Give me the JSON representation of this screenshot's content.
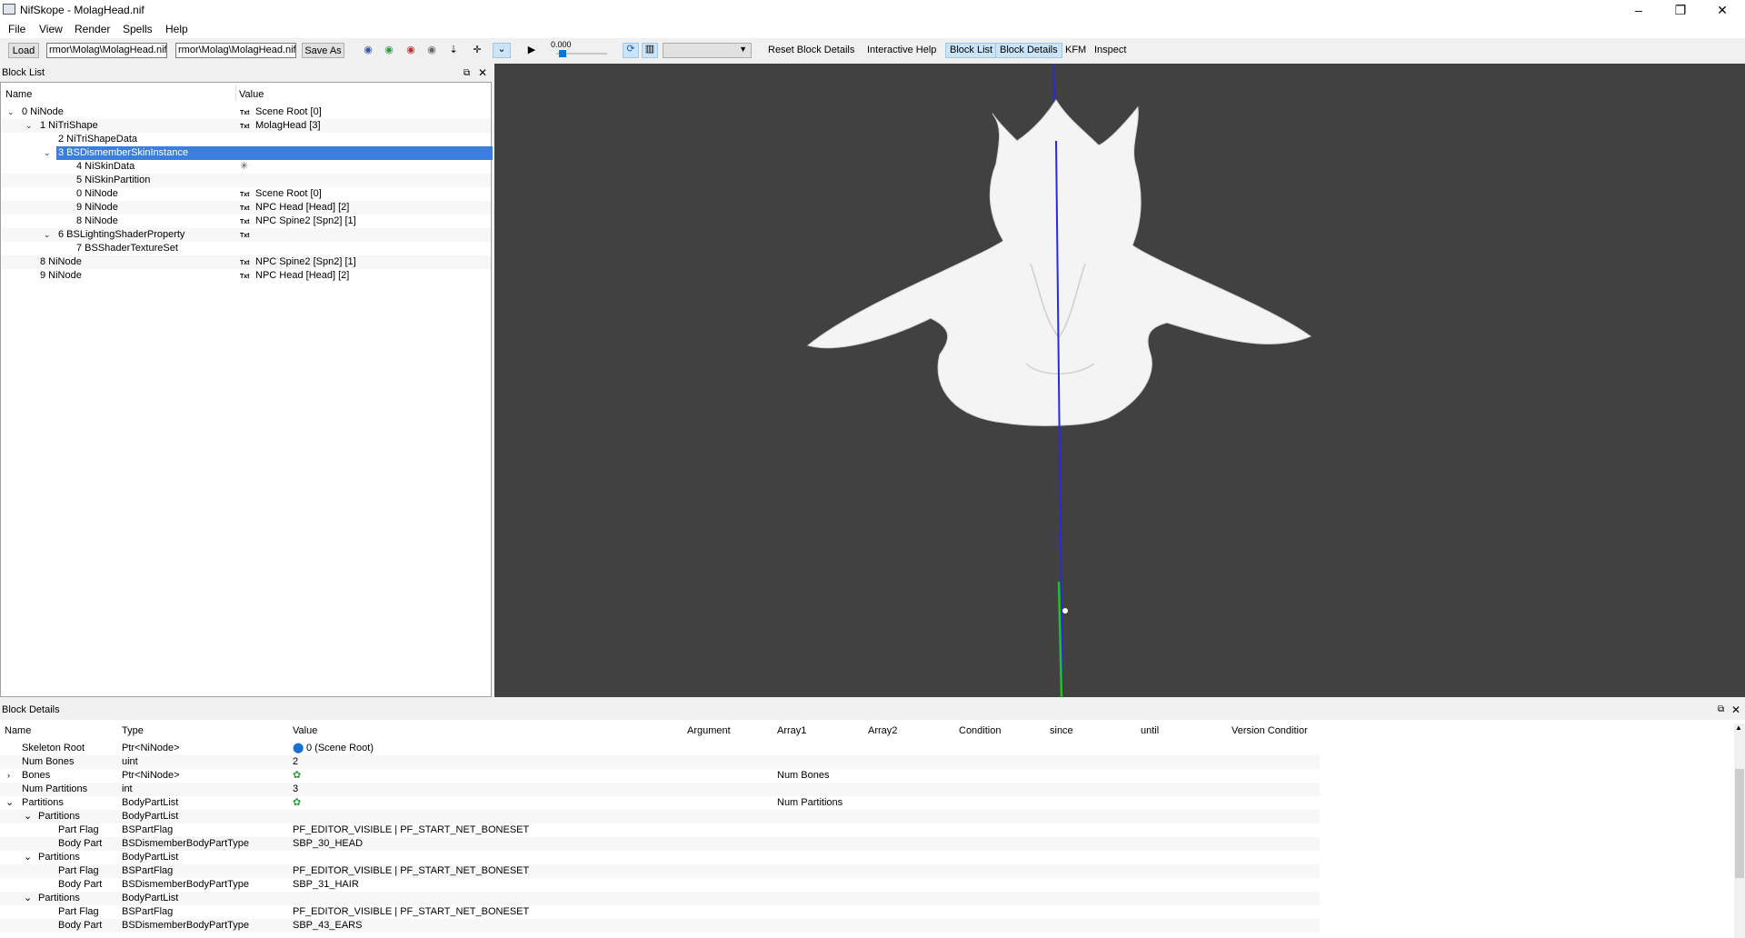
{
  "window": {
    "title": "NifSkope - MolagHead.nif",
    "controls": [
      "–",
      "❐",
      "✕"
    ]
  },
  "menu": [
    "File",
    "View",
    "Render",
    "Spells",
    "Help"
  ],
  "toolbar": {
    "load_label": "Load",
    "load_path": "rmor\\Molag\\MolagHead.nif",
    "save_path": "rmor\\Molag\\MolagHead.nif",
    "save_as_label": "Save As",
    "time_value": "0.000",
    "reset_label": "Reset Block Details",
    "help_label": "Interactive Help",
    "blocklist_label": "Block List",
    "blockdetails_label": "Block Details",
    "kfm_label": "KFM",
    "inspect_label": "Inspect"
  },
  "blocklist": {
    "panel_title": "Block List",
    "col_name": "Name",
    "col_value": "Value",
    "rows": [
      {
        "name": "0 NiNode",
        "value": "Scene Root [0]",
        "txt": "Txt"
      },
      {
        "name": "1 NiTriShape",
        "value": "MolagHead [3]",
        "txt": "Txt"
      },
      {
        "name": "2 NiTriShapeData",
        "value": "",
        "txt": ""
      },
      {
        "name": "3 BSDismemberSkinInstance",
        "value": "",
        "txt": ""
      },
      {
        "name": "4 NiSkinData",
        "value": "✳",
        "txt": ""
      },
      {
        "name": "5 NiSkinPartition",
        "value": "",
        "txt": ""
      },
      {
        "name": "0 NiNode",
        "value": "Scene Root [0]",
        "txt": "Txt"
      },
      {
        "name": "9 NiNode",
        "value": "NPC Head [Head] [2]",
        "txt": "Txt"
      },
      {
        "name": "8 NiNode",
        "value": "NPC Spine2 [Spn2] [1]",
        "txt": "Txt"
      },
      {
        "name": "6 BSLightingShaderProperty",
        "value": "",
        "txt": "Txt"
      },
      {
        "name": "7 BSShaderTextureSet",
        "value": "",
        "txt": ""
      },
      {
        "name": "8 NiNode",
        "value": "NPC Spine2 [Spn2] [1]",
        "txt": "Txt"
      },
      {
        "name": "9 NiNode",
        "value": "NPC Head [Head] [2]",
        "txt": "Txt"
      }
    ]
  },
  "details": {
    "panel_title": "Block Details",
    "columns": [
      "Name",
      "Type",
      "Value",
      "Argument",
      "Array1",
      "Array2",
      "Condition",
      "since",
      "until",
      "Version Conditior"
    ],
    "rows": [
      {
        "name": "Skeleton Root",
        "type": "Ptr<NiNode>",
        "value": "0 (Scene Root)",
        "array1": ""
      },
      {
        "name": "Num Bones",
        "type": "uint",
        "value": "2",
        "array1": ""
      },
      {
        "name": "Bones",
        "type": "Ptr<NiNode>",
        "value": "",
        "array1": "Num Bones"
      },
      {
        "name": "Num Partitions",
        "type": "int",
        "value": "3",
        "array1": ""
      },
      {
        "name": "Partitions",
        "type": "BodyPartList",
        "value": "",
        "array1": "Num Partitions"
      },
      {
        "name": "Partitions",
        "type": "BodyPartList",
        "value": "",
        "array1": ""
      },
      {
        "name": "Part Flag",
        "type": "BSPartFlag",
        "value": "PF_EDITOR_VISIBLE | PF_START_NET_BONESET",
        "array1": ""
      },
      {
        "name": "Body Part",
        "type": "BSDismemberBodyPartType",
        "value": "SBP_30_HEAD",
        "array1": ""
      },
      {
        "name": "Partitions",
        "type": "BodyPartList",
        "value": "",
        "array1": ""
      },
      {
        "name": "Part Flag",
        "type": "BSPartFlag",
        "value": "PF_EDITOR_VISIBLE | PF_START_NET_BONESET",
        "array1": ""
      },
      {
        "name": "Body Part",
        "type": "BSDismemberBodyPartType",
        "value": "SBP_31_HAIR",
        "array1": ""
      },
      {
        "name": "Partitions",
        "type": "BodyPartList",
        "value": "",
        "array1": ""
      },
      {
        "name": "Part Flag",
        "type": "BSPartFlag",
        "value": "PF_EDITOR_VISIBLE | PF_START_NET_BONESET",
        "array1": ""
      },
      {
        "name": "Body Part",
        "type": "BSDismemberBodyPartType",
        "value": "SBP_43_EARS",
        "array1": ""
      }
    ]
  },
  "colors": {
    "selection": "#3a7ede",
    "viewport_bg": "#414141",
    "axis_blue": "#2a2adc",
    "axis_green": "#22c022",
    "mesh": "#f4f4f4"
  }
}
